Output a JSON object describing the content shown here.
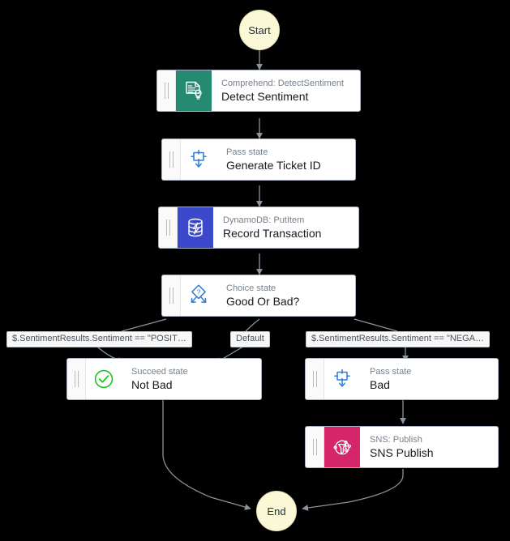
{
  "graph": {
    "start": {
      "label": "Start"
    },
    "end": {
      "label": "End"
    },
    "nodes": [
      {
        "id": "detect-sentiment",
        "resource": "Comprehend: DetectSentiment",
        "name": "Detect Sentiment",
        "icon": "comprehend-icon",
        "icon_color": "#248a72"
      },
      {
        "id": "generate-ticket-id",
        "resource": "Pass state",
        "name": "Generate Ticket ID",
        "icon": "pass-state-icon",
        "icon_color": "#2a7cd4"
      },
      {
        "id": "record-transaction",
        "resource": "DynamoDB: PutItem",
        "name": "Record Transaction",
        "icon": "dynamodb-icon",
        "icon_color": "#3b48cc"
      },
      {
        "id": "good-or-bad",
        "resource": "Choice state",
        "name": "Good Or Bad?",
        "icon": "choice-state-icon",
        "icon_color": "#2a7cd4"
      },
      {
        "id": "not-bad",
        "resource": "Succeed state",
        "name": "Not Bad",
        "icon": "succeed-state-icon",
        "icon_color": "#1ec21e"
      },
      {
        "id": "bad",
        "resource": "Pass state",
        "name": "Bad",
        "icon": "pass-state-icon",
        "icon_color": "#2a7cd4"
      },
      {
        "id": "sns-publish",
        "resource": "SNS: Publish",
        "name": "SNS Publish",
        "icon": "sns-icon",
        "icon_color": "#d6266a"
      }
    ],
    "edge_labels": [
      {
        "id": "positive",
        "text": "$.SentimentResults.Sentiment == \"POSIT…"
      },
      {
        "id": "default",
        "text": "Default"
      },
      {
        "id": "negative",
        "text": "$.SentimentResults.Sentiment == \"NEGA…"
      }
    ]
  },
  "colors": {
    "background": "#000000",
    "terminal_fill": "#fbf8d8",
    "edge_stroke": "#8a939e",
    "box_border": "#aab3c0",
    "subtitle": "#73808d",
    "title": "#16191f"
  }
}
